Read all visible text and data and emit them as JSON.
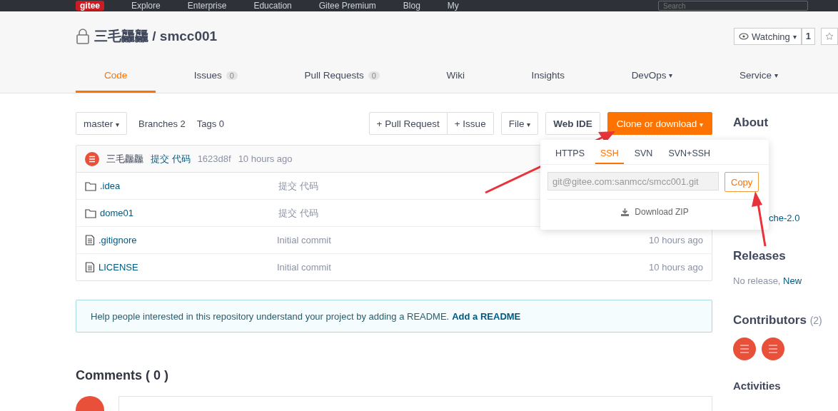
{
  "topnav": {
    "logo": "gitee",
    "items": [
      "Explore",
      "Enterprise",
      "Education",
      "Gitee Premium",
      "Blog",
      "My"
    ],
    "search": {
      "placeholder": "Search"
    }
  },
  "repo": {
    "title": "三毛龘龘 / smcc001",
    "watch": {
      "label": "Watching",
      "caret": "▾",
      "count": "1"
    }
  },
  "tabs": [
    {
      "label": "Code",
      "selected": true
    },
    {
      "label": "Issues",
      "count": "0",
      "selected": false
    },
    {
      "label": "Pull Requests",
      "count": "0",
      "selected": false
    },
    {
      "label": "Wiki",
      "selected": false
    },
    {
      "label": "Insights",
      "selected": false
    },
    {
      "label": "DevOps",
      "caret": "▾",
      "selected": false
    },
    {
      "label": "Service",
      "caret": "▾",
      "selected": false
    }
  ],
  "toolbar": {
    "branch": "master",
    "branch_caret": "▾",
    "branches": "Branches 2",
    "tags": "Tags 0",
    "pull_request": "+ Pull Request",
    "issue": "+ Issue",
    "file": "File",
    "file_caret": "▾",
    "web_ide": "Web IDE",
    "clone": "Clone or download",
    "clone_caret": "▾"
  },
  "commit": {
    "author": "三毛龘龘",
    "message": "提交 代码",
    "hash": "1623d8f",
    "time": "10 hours ago"
  },
  "files": [
    {
      "kind": "folder",
      "name": ".idea",
      "message": "提交 代码"
    },
    {
      "kind": "folder",
      "name": "dome01",
      "message": "提交 代码"
    },
    {
      "kind": "file",
      "name": ".gitignore",
      "message": "Initial commit",
      "time": "10 hours ago"
    },
    {
      "kind": "file",
      "name": "LICENSE",
      "message": "Initial commit",
      "time": "10 hours ago"
    }
  ],
  "readme_notice": {
    "text": "Help people interested in this repository understand your project by adding a README.",
    "link": "Add a README"
  },
  "comments": {
    "title": "Comments ( 0 )"
  },
  "clone_popover": {
    "tabs": [
      {
        "label": "HTTPS",
        "selected": false
      },
      {
        "label": "SSH",
        "selected": true
      },
      {
        "label": "SVN",
        "selected": false
      },
      {
        "label": "SVN+SSH",
        "selected": false
      }
    ],
    "url": "git@gitee.com:sanmcc/smcc001.git",
    "copy": "Copy",
    "download": "Download ZIP"
  },
  "sidebar": {
    "about": "About",
    "license_fragment": "che-2.0",
    "releases": "Releases",
    "no_release": "No release,",
    "new_link": "New",
    "contributors": "Contributors",
    "contributors_count": "(2)",
    "activities": "Activities"
  }
}
